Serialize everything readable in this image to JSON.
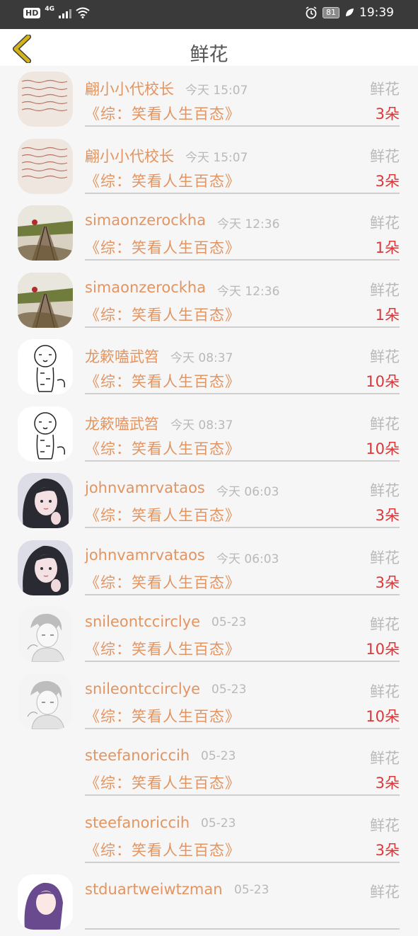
{
  "status_bar": {
    "hd": "HD",
    "network": "4G",
    "battery": "81",
    "time": "19:39"
  },
  "header": {
    "title": "鲜花"
  },
  "rows": [
    {
      "name": "翩小小代校长",
      "time": "今天 15:07",
      "type": "鲜花",
      "book": "《综：笑看人生百态》",
      "count": "3朵",
      "avatar": "note-avatar"
    },
    {
      "name": "翩小小代校长",
      "time": "今天 15:07",
      "type": "鲜花",
      "book": "《综：笑看人生百态》",
      "count": "3朵",
      "avatar": "note-avatar"
    },
    {
      "name": "simaonzerockha",
      "time": "今天 12:36",
      "type": "鲜花",
      "book": "《综：笑看人生百态》",
      "count": "1朵",
      "avatar": "railway-avatar"
    },
    {
      "name": "simaonzerockha",
      "time": "今天 12:36",
      "type": "鲜花",
      "book": "《综：笑看人生百态》",
      "count": "1朵",
      "avatar": "railway-avatar"
    },
    {
      "name": "龙簌嗑武笤",
      "time": "今天 08:37",
      "type": "鲜花",
      "book": "《综：笑看人生百态》",
      "count": "10朵",
      "avatar": "tiger-avatar"
    },
    {
      "name": "龙簌嗑武笤",
      "time": "今天 08:37",
      "type": "鲜花",
      "book": "《综：笑看人生百态》",
      "count": "10朵",
      "avatar": "tiger-avatar"
    },
    {
      "name": "johnvamrvataos",
      "time": "今天 06:03",
      "type": "鲜花",
      "book": "《综：笑看人生百态》",
      "count": "3朵",
      "avatar": "girl-avatar"
    },
    {
      "name": "johnvamrvataos",
      "time": "今天 06:03",
      "type": "鲜花",
      "book": "《综：笑看人生百态》",
      "count": "3朵",
      "avatar": "girl-avatar"
    },
    {
      "name": "snileontccirclye",
      "time": "05-23",
      "type": "鲜花",
      "book": "《综：笑看人生百态》",
      "count": "10朵",
      "avatar": "sketch-avatar"
    },
    {
      "name": "snileontccirclye",
      "time": "05-23",
      "type": "鲜花",
      "book": "《综：笑看人生百态》",
      "count": "10朵",
      "avatar": "sketch-avatar"
    },
    {
      "name": "steefanoriccih",
      "time": "05-23",
      "type": "鲜花",
      "book": "《综：笑看人生百态》",
      "count": "3朵",
      "avatar": "blank-avatar"
    },
    {
      "name": "steefanoriccih",
      "time": "05-23",
      "type": "鲜花",
      "book": "《综：笑看人生百态》",
      "count": "3朵",
      "avatar": "blank-avatar"
    },
    {
      "name": "stduartweiwtzman",
      "time": "05-23",
      "type": "鲜花",
      "book": "",
      "count": "",
      "avatar": "purple-hair-avatar"
    }
  ],
  "colors": {
    "accent_orange": "#e29461",
    "count_red": "#d9383a",
    "muted_gray": "#b9b9b9",
    "back_arrow": "#d4b21c"
  }
}
